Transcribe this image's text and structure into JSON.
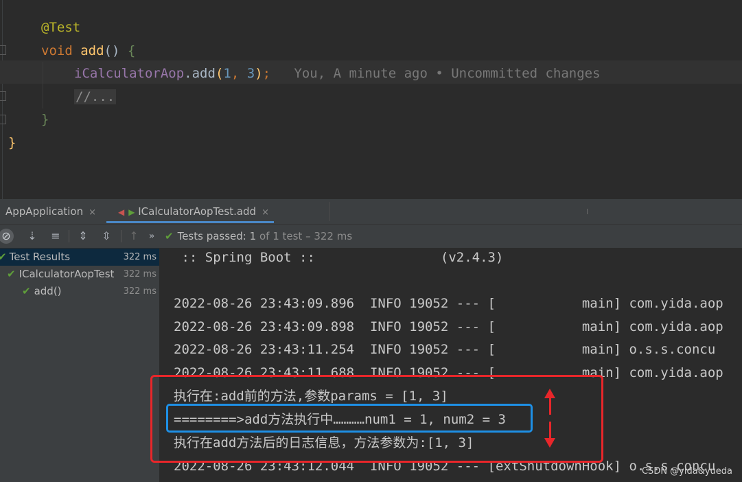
{
  "editor": {
    "annotation": "@Test",
    "kw_void": "void",
    "method_name": "add",
    "method_parens": "()",
    "open_brace": "{",
    "call_target": "iCalculatorAop",
    "call_dot": ".",
    "call_method": "add",
    "call_open": "(",
    "arg1": "1",
    "arg_sep": ", ",
    "arg2": "3",
    "call_close": ")",
    "semicolon": ";",
    "blame": "You, A minute ago • Uncommitted changes",
    "collapsed_comment": "//...",
    "close_inner": "}",
    "close_outer": "}"
  },
  "tabs": [
    {
      "label": "AppApplication",
      "close": "×"
    },
    {
      "label": "ICalculatorAopTest.add",
      "close": "×"
    }
  ],
  "toolbar": {
    "status_label": "Tests passed:",
    "status_count": "1",
    "status_rest": "of 1 test – 322 ms"
  },
  "tree": {
    "root": {
      "label": "Test Results",
      "time": "322 ms"
    },
    "class": {
      "label": "ICalculatorAopTest",
      "time": "322 ms"
    },
    "method": {
      "label": "add()",
      "time": "322 ms"
    }
  },
  "console": {
    "lines": [
      " :: Spring Boot ::                (v2.4.3)",
      "",
      "2022-08-26 23:43:09.896  INFO 19052 --- [           main] com.yida.aop",
      "2022-08-26 23:43:09.898  INFO 19052 --- [           main] com.yida.aop",
      "2022-08-26 23:43:11.254  INFO 19052 --- [           main] o.s.s.concu",
      "2022-08-26 23:43:11.688  INFO 19052 --- [           main] com.yida.aop",
      "执行在:add前的方法,参数params = [1, 3]",
      "========>add方法执行中…………num1 = 1, num2 = 3",
      "执行在add方法后的日志信息，方法参数为:[1, 3]",
      "2022-08-26 23:43:12.044  INFO 19052 --- [extShutdownHook] o.s.s.concu"
    ]
  },
  "watermark": "CSDN @yida&yueda",
  "colors": {
    "highlight_red": "#e8262a",
    "highlight_blue": "#1e90e6",
    "pass_green": "#5f9e3a"
  }
}
